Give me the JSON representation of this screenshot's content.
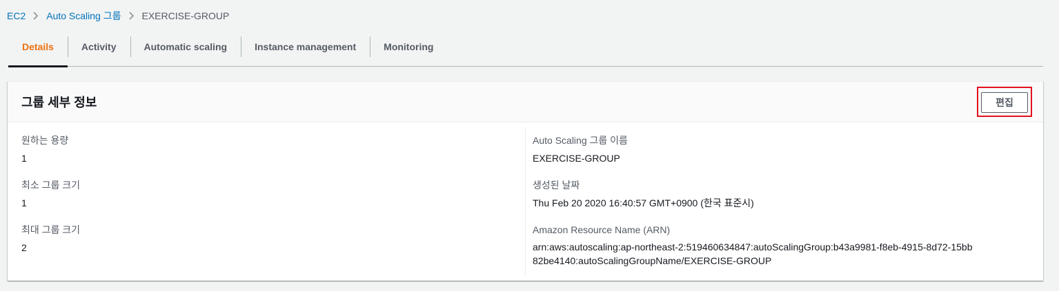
{
  "breadcrumb": {
    "items": [
      "EC2",
      "Auto Scaling 그룹"
    ],
    "current": "EXERCISE-GROUP"
  },
  "tabs": [
    {
      "label": "Details",
      "active": true
    },
    {
      "label": "Activity",
      "active": false
    },
    {
      "label": "Automatic scaling",
      "active": false
    },
    {
      "label": "Instance management",
      "active": false
    },
    {
      "label": "Monitoring",
      "active": false
    }
  ],
  "panel": {
    "title": "그룹 세부 정보",
    "edit_label": "편집",
    "left": [
      {
        "label": "원하는 용량",
        "value": "1"
      },
      {
        "label": "최소 그룹 크기",
        "value": "1"
      },
      {
        "label": "최대 그룹 크기",
        "value": "2"
      }
    ],
    "right": [
      {
        "label": "Auto Scaling 그룹 이름",
        "value": "EXERCISE-GROUP"
      },
      {
        "label": "생성된 날짜",
        "value": "Thu Feb 20 2020 16:40:57 GMT+0900 (한국 표준시)"
      },
      {
        "label": "Amazon Resource Name (ARN)",
        "value": "arn:aws:autoscaling:ap-northeast-2:519460634847:autoScalingGroup:b43a9981-f8eb-4915-8d72-15bb82be4140:autoScalingGroupName/EXERCISE-GROUP"
      }
    ]
  },
  "colors": {
    "link": "#0073bb",
    "active_tab": "#ec7211",
    "highlight": "#e3101c",
    "page_bg": "#f2f3f3"
  }
}
